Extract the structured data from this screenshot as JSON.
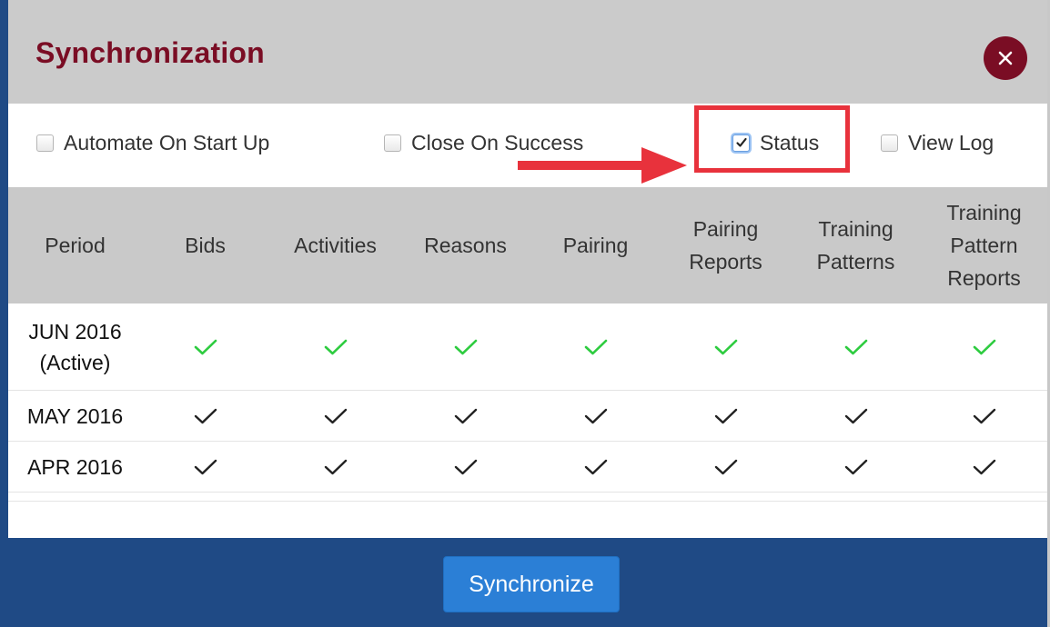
{
  "dialog": {
    "title": "Synchronization",
    "close_icon": "close-icon"
  },
  "options": [
    {
      "label": "Automate On Start Up",
      "checked": false
    },
    {
      "label": "Close On Success",
      "checked": false
    },
    {
      "label": "Status",
      "checked": true
    },
    {
      "label": "View Log",
      "checked": false
    }
  ],
  "annotation": {
    "arrow_color": "#e8323c",
    "highlight_color": "#e8323c"
  },
  "table": {
    "headers": [
      "Period",
      "Bids",
      "Activities",
      "Reasons",
      "Pairing",
      "Pairing Reports",
      "Training Patterns",
      "Training Pattern Reports"
    ],
    "rows": [
      {
        "period": "JUN 2016 (Active)",
        "status": "active",
        "checks": [
          true,
          true,
          true,
          true,
          true,
          true,
          true
        ]
      },
      {
        "period": "MAY 2016",
        "status": "synced",
        "checks": [
          true,
          true,
          true,
          true,
          true,
          true,
          true
        ]
      },
      {
        "period": "APR 2016",
        "status": "synced",
        "checks": [
          true,
          true,
          true,
          true,
          true,
          true,
          true
        ]
      }
    ]
  },
  "colors": {
    "title": "#7a0d24",
    "active_check": "#2ecc40",
    "check": "#222222",
    "footer": "#1f4a85",
    "button": "#2b7fd6"
  },
  "footer": {
    "sync_label": "Synchronize"
  }
}
